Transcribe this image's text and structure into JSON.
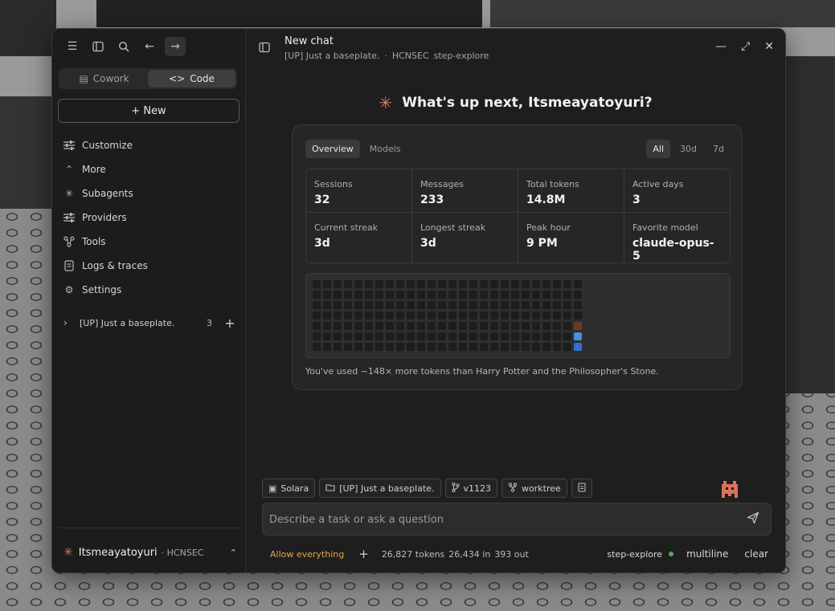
{
  "app": {
    "modes": [
      {
        "label": "Cowork",
        "icon": "document-icon",
        "active": false
      },
      {
        "label": "Code",
        "icon": "code-icon",
        "active": true
      }
    ],
    "new_button": "+ New",
    "nav": [
      {
        "label": "Customize",
        "icon": "sliders-icon"
      },
      {
        "label": "More",
        "icon": "chevron-up-icon"
      },
      {
        "label": "Subagents",
        "icon": "asterisk-icon"
      },
      {
        "label": "Providers",
        "icon": "sliders-icon"
      },
      {
        "label": "Tools",
        "icon": "nodes-icon"
      },
      {
        "label": "Logs & traces",
        "icon": "log-icon"
      },
      {
        "label": "Settings",
        "icon": "gear-icon"
      }
    ],
    "project": {
      "name": "[UP] Just a baseplate.",
      "count": "3"
    },
    "user": {
      "name": "Itsmeayatoyuri",
      "org": "· HCNSEC"
    }
  },
  "header": {
    "title": "New chat",
    "sub_project": "[UP] Just a baseplate.",
    "sub_sep": "·",
    "sub_org": "HCNSEC",
    "sub_model": "step-explore"
  },
  "greeting": "What's up next, Itsmeayatoyuri?",
  "stats": {
    "tabs": [
      "Overview",
      "Models"
    ],
    "ranges": [
      "All",
      "30d",
      "7d"
    ],
    "cards": [
      {
        "label": "Sessions",
        "value": "32"
      },
      {
        "label": "Messages",
        "value": "233"
      },
      {
        "label": "Total tokens",
        "value": "14.8M"
      },
      {
        "label": "Active days",
        "value": "3"
      },
      {
        "label": "Current streak",
        "value": "3d"
      },
      {
        "label": "Longest streak",
        "value": "3d"
      },
      {
        "label": "Peak hour",
        "value": "9 PM"
      },
      {
        "label": "Favorite model",
        "value": "claude-opus-5"
      }
    ],
    "heatmap": {
      "weeks": 26,
      "days": 7,
      "active_cells": [
        {
          "week": 25,
          "day": 4,
          "color": "#6b3a2e"
        },
        {
          "week": 25,
          "day": 5,
          "color": "#4a90d9"
        },
        {
          "week": 25,
          "day": 6,
          "color": "#2f6fd6"
        }
      ]
    },
    "note": "You've used ~148× more tokens than Harry Potter and the Philosopher's Stone."
  },
  "chips": [
    {
      "label": "Solara",
      "icon": "terminal-icon"
    },
    {
      "label": "[UP] Just a baseplate.",
      "icon": "folder-icon"
    },
    {
      "label": "v1123",
      "icon": "branch-icon"
    },
    {
      "label": "worktree",
      "icon": "worktree-icon"
    }
  ],
  "composer": {
    "placeholder": "Describe a task or ask a question"
  },
  "footer": {
    "permission": "Allow everything",
    "tokens": "26,827 tokens",
    "in": "26,434 in",
    "out": "393 out",
    "model": "step-explore",
    "multiline": "multiline",
    "clear": "clear"
  },
  "colors": {
    "accent": "#e07a5f",
    "allow": "#e0a84f",
    "status_ok": "#4caf50"
  }
}
